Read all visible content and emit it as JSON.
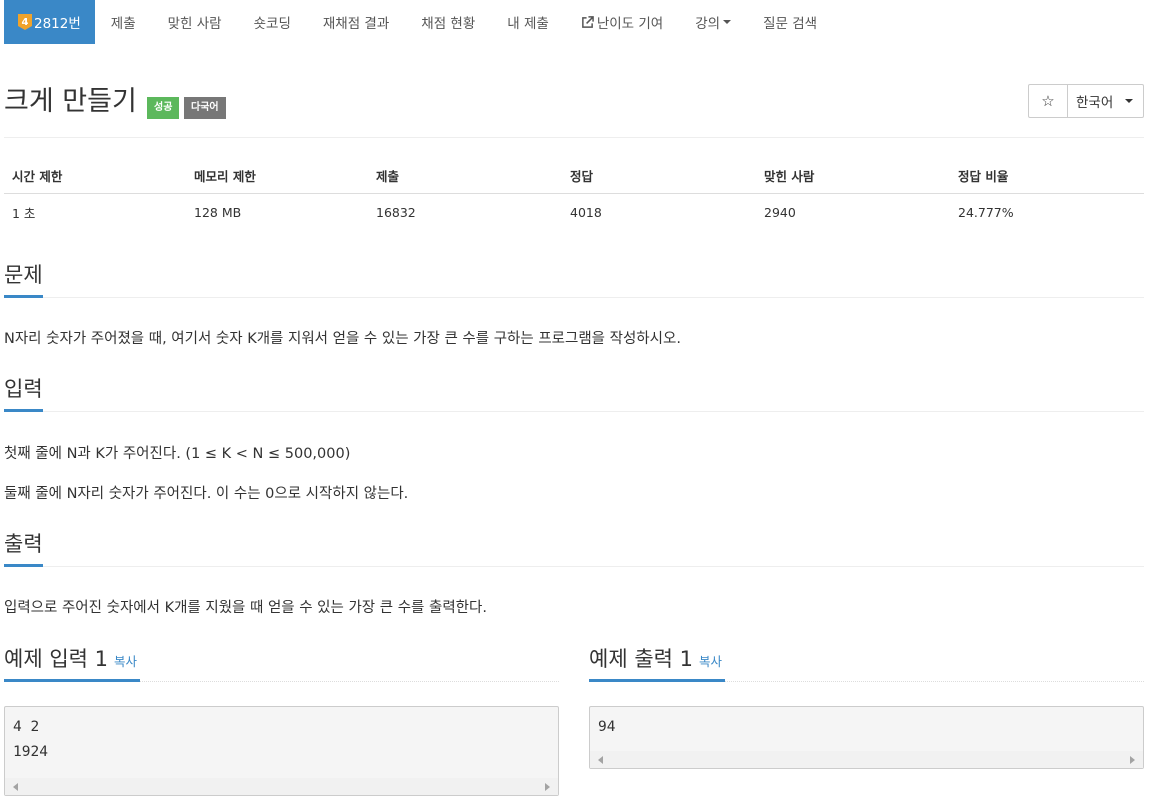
{
  "nav": {
    "problem_number": "2812번",
    "tier_badge": "4",
    "items": [
      "제출",
      "맞힌 사람",
      "숏코딩",
      "재채점 결과",
      "채점 현황",
      "내 제출",
      "난이도 기여",
      "강의",
      "질문 검색"
    ]
  },
  "problem": {
    "title": "크게 만들기",
    "label_success": "성공",
    "label_multilang": "다국어",
    "star": "☆",
    "language": "한국어"
  },
  "info_table": {
    "headers": [
      "시간 제한",
      "메모리 제한",
      "제출",
      "정답",
      "맞힌 사람",
      "정답 비율"
    ],
    "values": [
      "1 초",
      "128 MB",
      "16832",
      "4018",
      "2940",
      "24.777%"
    ]
  },
  "sections": {
    "problem_heading": "문제",
    "problem_text": "N자리 숫자가 주어졌을 때, 여기서 숫자 K개를 지워서 얻을 수 있는 가장 큰 수를 구하는 프로그램을 작성하시오.",
    "input_heading": "입력",
    "input_text_1": "첫째 줄에 N과 K가 주어진다. (1 ≤ K < N ≤ 500,000)",
    "input_text_2": "둘째 줄에 N자리 숫자가 주어진다. 이 수는 0으로 시작하지 않는다.",
    "output_heading": "출력",
    "output_text": "입력으로 주어진 숫자에서 K개를 지웠을 때 얻을 수 있는 가장 큰 수를 출력한다."
  },
  "samples": {
    "input_heading": "예제 입력 1",
    "output_heading": "예제 출력 1",
    "copy": "복사",
    "input_value": "4 2\n1924",
    "output_value": "94"
  },
  "colors": {
    "accent": "#3a88c7",
    "success": "#5cb85c",
    "multilang": "#777777",
    "tier": "#f0a32a"
  }
}
